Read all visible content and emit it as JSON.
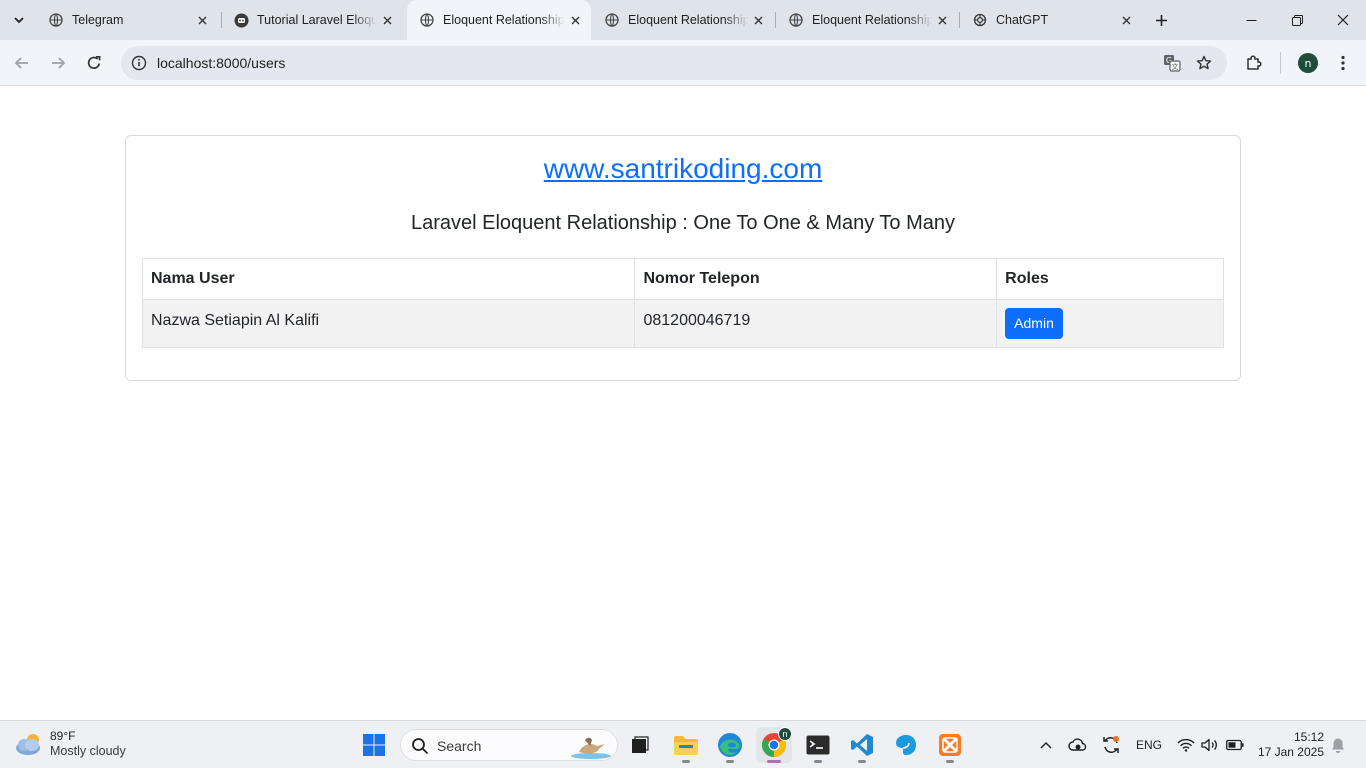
{
  "browser": {
    "tabs": [
      {
        "title": "Telegram",
        "icon": "telegram-icon"
      },
      {
        "title": "Tutorial Laravel Eloquent",
        "icon": "santrikoding-icon"
      },
      {
        "title": "Eloquent Relationship",
        "icon": "globe-icon",
        "active": true
      },
      {
        "title": "Eloquent Relationship",
        "icon": "globe-icon"
      },
      {
        "title": "Eloquent Relationship",
        "icon": "globe-icon"
      },
      {
        "title": "ChatGPT",
        "icon": "chatgpt-icon"
      }
    ],
    "address": "localhost:8000/users",
    "profile_initial": "n"
  },
  "page": {
    "site_link": "www.santrikoding.com",
    "heading": "Laravel Eloquent Relationship : One To One & Many To Many",
    "table": {
      "headers": [
        "Nama User",
        "Nomor Telepon",
        "Roles"
      ],
      "rows": [
        {
          "name": "Nazwa Setiapin Al Kalifi",
          "phone": "081200046719",
          "role": "Admin"
        }
      ]
    }
  },
  "taskbar": {
    "weather_temp": "89°F",
    "weather_condition": "Mostly cloudy",
    "search_label": "Search",
    "language": "ENG",
    "time": "15:12",
    "date": "17 Jan 2025",
    "chrome_badge": "n"
  },
  "colors": {
    "link": "#0d6efd",
    "badge": "#0d6efd",
    "tabstrip": "#dfe3ea",
    "toolbar": "#f1f4f9"
  }
}
